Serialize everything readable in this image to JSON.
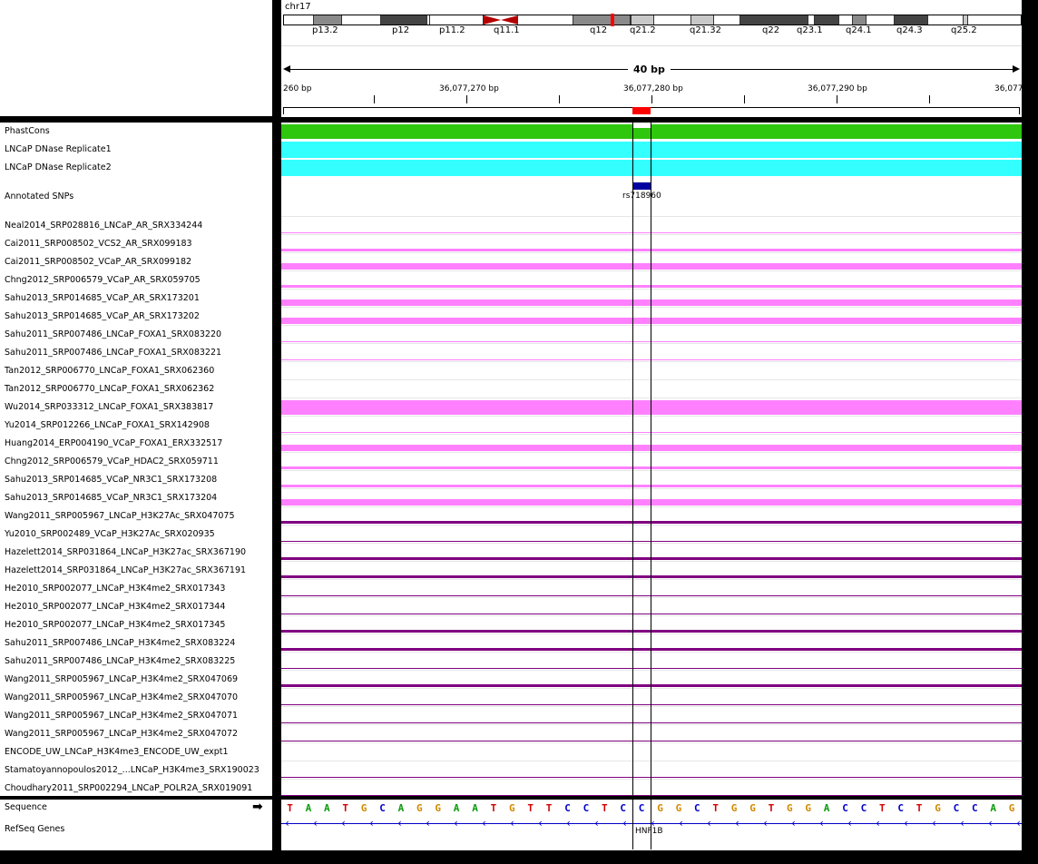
{
  "chromosome": "chr17",
  "ideogram_bands": [
    {
      "label": "p13.2",
      "color": "#8a8a8a"
    },
    {
      "label": "p12",
      "color": "#444444"
    },
    {
      "label": "p11.2",
      "color": "#ffffff"
    },
    {
      "label": "q11.1",
      "color": "#b40000"
    },
    {
      "label": "q12",
      "color": "#8a8a8a"
    },
    {
      "label": "q21.2",
      "color": "#c8c8c8"
    },
    {
      "label": "q21.32",
      "color": "#c8c8c8"
    },
    {
      "label": "q22",
      "color": "#444444"
    },
    {
      "label": "q23.1",
      "color": "#444444"
    },
    {
      "label": "q24.1",
      "color": "#8a8a8a"
    },
    {
      "label": "q24.3",
      "color": "#444444"
    },
    {
      "label": "q25.2",
      "color": "#c8c8c8"
    }
  ],
  "ruler": {
    "span_label": "40 bp",
    "ticks": [
      "260 bp",
      "36,077,270 bp",
      "36,077,280 bp",
      "36,077,290 bp",
      "36,077"
    ]
  },
  "tracks": [
    {
      "label": "PhastCons",
      "type": "phast"
    },
    {
      "label": "LNCaP DNase Replicate1",
      "type": "dnase"
    },
    {
      "label": "LNCaP DNase Replicate2",
      "type": "dnase"
    },
    {
      "label": "Annotated SNPs",
      "type": "snp",
      "feature": "rs718960"
    },
    {
      "label": "Neal2014_SRP028816_LNCaP_AR_SRX334244",
      "type": "pink",
      "level": "faint"
    },
    {
      "label": "Cai2011_SRP008502_VCS2_AR_SRX099183",
      "type": "pink",
      "level": "thin"
    },
    {
      "label": "Cai2011_SRP008502_VCaP_AR_SRX099182",
      "type": "pink",
      "level": "medium"
    },
    {
      "label": "Chng2012_SRP006579_VCaP_AR_SRX059705",
      "type": "pink",
      "level": "thin"
    },
    {
      "label": "Sahu2013_SRP014685_VCaP_AR_SRX173201",
      "type": "pink",
      "level": "medium"
    },
    {
      "label": "Sahu2013_SRP014685_VCaP_AR_SRX173202",
      "type": "pink",
      "level": "medium"
    },
    {
      "label": "Sahu2011_SRP007486_LNCaP_FOXA1_SRX083220",
      "type": "pink",
      "level": "faint"
    },
    {
      "label": "Sahu2011_SRP007486_LNCaP_FOXA1_SRX083221",
      "type": "pink",
      "level": "faint"
    },
    {
      "label": "Tan2012_SRP006770_LNCaP_FOXA1_SRX062360",
      "type": "pink",
      "level": "none"
    },
    {
      "label": "Tan2012_SRP006770_LNCaP_FOXA1_SRX062362",
      "type": "pink",
      "level": "none"
    },
    {
      "label": "Wu2014_SRP033312_LNCaP_FOXA1_SRX383817",
      "type": "pink",
      "level": "full"
    },
    {
      "label": "Yu2014_SRP012266_LNCaP_FOXA1_SRX142908",
      "type": "pink",
      "level": "faint"
    },
    {
      "label": "Huang2014_ERP004190_VCaP_FOXA1_ERX332517",
      "type": "pink",
      "level": "medium"
    },
    {
      "label": "Chng2012_SRP006579_VCaP_HDAC2_SRX059711",
      "type": "pink",
      "level": "thin"
    },
    {
      "label": "Sahu2013_SRP014685_VCaP_NR3C1_SRX173208",
      "type": "pink",
      "level": "thin"
    },
    {
      "label": "Sahu2013_SRP014685_VCaP_NR3C1_SRX173204",
      "type": "pink",
      "level": "medium"
    },
    {
      "label": "Wang2011_SRP005967_LNCaP_H3K27Ac_SRX047075",
      "type": "purple",
      "level": "thin"
    },
    {
      "label": "Yu2010_SRP002489_VCaP_H3K27Ac_SRX020935",
      "type": "purple",
      "level": "faint"
    },
    {
      "label": "Hazelett2014_SRP031864_LNCaP_H3K27ac_SRX367190",
      "type": "purple",
      "level": "thin"
    },
    {
      "label": "Hazelett2014_SRP031864_LNCaP_H3K27ac_SRX367191",
      "type": "purple",
      "level": "thin"
    },
    {
      "label": "He2010_SRP002077_LNCaP_H3K4me2_SRX017343",
      "type": "purple",
      "level": "faint"
    },
    {
      "label": "He2010_SRP002077_LNCaP_H3K4me2_SRX017344",
      "type": "purple",
      "level": "faint"
    },
    {
      "label": "He2010_SRP002077_LNCaP_H3K4me2_SRX017345",
      "type": "purple",
      "level": "thin"
    },
    {
      "label": "Sahu2011_SRP007486_LNCaP_H3K4me2_SRX083224",
      "type": "purple",
      "level": "thin"
    },
    {
      "label": "Sahu2011_SRP007486_LNCaP_H3K4me2_SRX083225",
      "type": "purple",
      "level": "faint"
    },
    {
      "label": "Wang2011_SRP005967_LNCaP_H3K4me2_SRX047069",
      "type": "purple",
      "level": "thin"
    },
    {
      "label": "Wang2011_SRP005967_LNCaP_H3K4me2_SRX047070",
      "type": "purple",
      "level": "faint"
    },
    {
      "label": "Wang2011_SRP005967_LNCaP_H3K4me2_SRX047071",
      "type": "purple",
      "level": "faint"
    },
    {
      "label": "Wang2011_SRP005967_LNCaP_H3K4me2_SRX047072",
      "type": "purple",
      "level": "faint"
    },
    {
      "label": "ENCODE_UW_LNCaP_H3K4me3_ENCODE_UW_expt1",
      "type": "purple",
      "level": "none"
    },
    {
      "label": "Stamatoyannopoulos2012_...LNCaP_H3K4me3_SRX190023",
      "type": "purple",
      "level": "faint"
    },
    {
      "label": "Choudhary2011_SRP002294_LNCaP_POLR2A_SRX019091",
      "type": "purple",
      "level": "faint"
    }
  ],
  "sequence": {
    "label": "Sequence",
    "bases": "TAATGCAGGAATGTTCCTCCGGCTGGTGGACCTCTGCCAG"
  },
  "genes": {
    "label": "RefSeq Genes",
    "name": "HNF1B"
  },
  "colors": {
    "A": "#0a9a0a",
    "C": "#0000c8",
    "G": "#d18a00",
    "T": "#d20000",
    "pink": "#ff80ff",
    "purple": "#800080",
    "phast": "#2ec70d",
    "dnase": "#33ffff",
    "snp": "#0000a0"
  }
}
